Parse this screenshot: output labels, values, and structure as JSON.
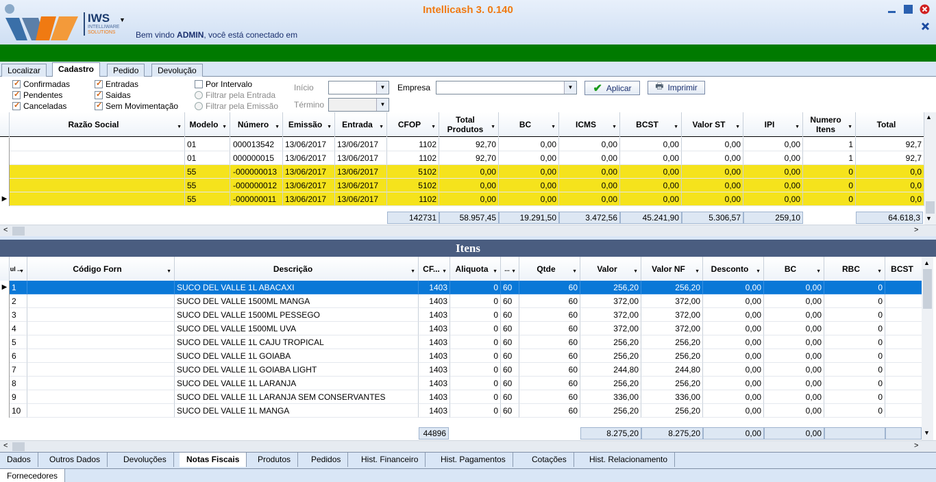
{
  "app": {
    "title": "Intellicash 3. 0.140",
    "welcome_prefix": "Bem vindo ",
    "user": "ADMIN",
    "welcome_suffix": ", você está conectado em",
    "logo_text": "IWS",
    "logo_sub1": "INTELLIWARE",
    "logo_sub2": "SOLUTIONS"
  },
  "top_tabs": [
    {
      "label": "Localizar"
    },
    {
      "label": "Cadastro"
    },
    {
      "label": "Pedido"
    },
    {
      "label": "Devolução"
    }
  ],
  "filters": {
    "confirmadas": "Confirmadas",
    "pendentes": "Pendentes",
    "canceladas": "Canceladas",
    "entradas": "Entradas",
    "saidas": "Saidas",
    "sem_mov": "Sem Movimentação",
    "por_intervalo": "Por Intervalo",
    "filtrar_entrada": "Filtrar pela Entrada",
    "filtrar_emissao": "Filtrar pela Emissão",
    "inicio": "Início",
    "termino": "Término",
    "empresa": "Empresa",
    "aplicar": "Aplicar",
    "imprimir": "Imprimir"
  },
  "notas": {
    "headers": [
      "Razão Social",
      "Modelo",
      "Número",
      "Emissão",
      "Entrada",
      "CFOP",
      "Total Produtos",
      "BC",
      "ICMS",
      "BCST",
      "Valor ST",
      "IPI",
      "Numero Itens",
      "Total"
    ],
    "rows": [
      [
        "",
        "01",
        "000013542",
        "13/06/2017",
        "13/06/2017",
        "1102",
        "92,70",
        "0,00",
        "0,00",
        "0,00",
        "0,00",
        "0,00",
        "1",
        "92,7"
      ],
      [
        "",
        "01",
        "000000015",
        "13/06/2017",
        "13/06/2017",
        "1102",
        "92,70",
        "0,00",
        "0,00",
        "0,00",
        "0,00",
        "0,00",
        "1",
        "92,7"
      ],
      [
        "",
        "55",
        "-000000013",
        "13/06/2017",
        "13/06/2017",
        "5102",
        "0,00",
        "0,00",
        "0,00",
        "0,00",
        "0,00",
        "0,00",
        "0",
        "0,0"
      ],
      [
        "",
        "55",
        "-000000012",
        "13/06/2017",
        "13/06/2017",
        "5102",
        "0,00",
        "0,00",
        "0,00",
        "0,00",
        "0,00",
        "0,00",
        "0",
        "0,0"
      ],
      [
        "",
        "55",
        "-000000011",
        "13/06/2017",
        "13/06/2017",
        "1102",
        "0,00",
        "0,00",
        "0,00",
        "0,00",
        "0,00",
        "0,00",
        "0",
        "0,0"
      ]
    ],
    "totals": {
      "cfop": "142731",
      "total_produtos": "58.957,45",
      "bc": "19.291,50",
      "icms": "3.472,56",
      "bcst": "45.241,90",
      "valor_st": "5.306,57",
      "ipi": "259,10",
      "total": "64.618,3"
    }
  },
  "itens": {
    "title": "Itens",
    "headers": [
      "ul ..",
      "Código Forn",
      "Descrição",
      "CF...",
      "Aliquota",
      "...",
      "Qtde",
      "Valor",
      "Valor NF",
      "Desconto",
      "BC",
      "RBC",
      "BCST"
    ],
    "rows": [
      [
        "1",
        "",
        "SUCO DEL VALLE 1L ABACAXI",
        "1403",
        "0",
        "60",
        "60",
        "256,20",
        "256,20",
        "0,00",
        "0,00",
        "0",
        ""
      ],
      [
        "2",
        "",
        "SUCO DEL VALLE 1500ML MANGA",
        "1403",
        "0",
        "60",
        "60",
        "372,00",
        "372,00",
        "0,00",
        "0,00",
        "0",
        ""
      ],
      [
        "3",
        "",
        "SUCO DEL VALLE 1500ML PESSEGO",
        "1403",
        "0",
        "60",
        "60",
        "372,00",
        "372,00",
        "0,00",
        "0,00",
        "0",
        ""
      ],
      [
        "4",
        "",
        "SUCO DEL VALLE 1500ML UVA",
        "1403",
        "0",
        "60",
        "60",
        "372,00",
        "372,00",
        "0,00",
        "0,00",
        "0",
        ""
      ],
      [
        "5",
        "",
        "SUCO DEL VALLE 1L CAJU TROPICAL",
        "1403",
        "0",
        "60",
        "60",
        "256,20",
        "256,20",
        "0,00",
        "0,00",
        "0",
        ""
      ],
      [
        "6",
        "",
        "SUCO DEL VALLE 1L GOIABA",
        "1403",
        "0",
        "60",
        "60",
        "256,20",
        "256,20",
        "0,00",
        "0,00",
        "0",
        ""
      ],
      [
        "7",
        "",
        "SUCO DEL VALLE 1L GOIABA LIGHT",
        "1403",
        "0",
        "60",
        "60",
        "244,80",
        "244,80",
        "0,00",
        "0,00",
        "0",
        ""
      ],
      [
        "8",
        "",
        "SUCO DEL VALLE 1L LARANJA",
        "1403",
        "0",
        "60",
        "60",
        "256,20",
        "256,20",
        "0,00",
        "0,00",
        "0",
        ""
      ],
      [
        "9",
        "",
        "SUCO DEL VALLE 1L LARANJA SEM CONSERVANTES",
        "1403",
        "0",
        "60",
        "60",
        "336,00",
        "336,00",
        "0,00",
        "0,00",
        "0",
        ""
      ],
      [
        "10",
        "",
        "SUCO DEL VALLE 1L MANGA",
        "1403",
        "0",
        "60",
        "60",
        "256,20",
        "256,20",
        "0,00",
        "0,00",
        "0",
        ""
      ]
    ],
    "totals": {
      "cf": "44896",
      "valor": "8.275,20",
      "valor_nf": "8.275,20",
      "desconto": "0,00",
      "bc": "0,00"
    }
  },
  "bottom_tabs": [
    {
      "label": "Dados"
    },
    {
      "label": "Outros Dados"
    },
    {
      "label": "Devoluções"
    },
    {
      "label": "Notas Fiscais"
    },
    {
      "label": "Produtos"
    },
    {
      "label": "Pedidos"
    },
    {
      "label": "Hist. Financeiro"
    },
    {
      "label": "Hist. Pagamentos"
    },
    {
      "label": "Cotações"
    },
    {
      "label": "Hist. Relacionamento"
    }
  ],
  "footer_tabs": [
    {
      "label": "Fornecedores"
    }
  ],
  "colors": {
    "accent": "#f07a12",
    "green_bar": "#007a00",
    "highlight": "#f5e31c",
    "selection": "#0a78d7"
  }
}
